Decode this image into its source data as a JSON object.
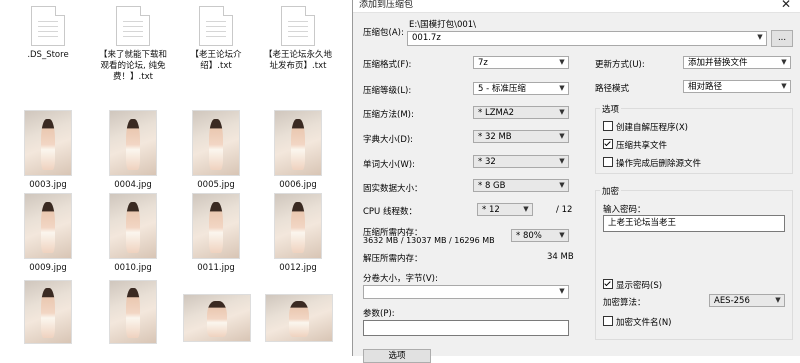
{
  "explorer": {
    "files": [
      {
        "name": ".DS_Store",
        "kind": "doc"
      },
      {
        "name": "【来了就能下载和观看的论坛, 纯免费！】.txt",
        "kind": "doc"
      },
      {
        "name": "【老王论坛介绍】.txt",
        "kind": "doc"
      },
      {
        "name": "【老王论坛永久地址发布页】.txt",
        "kind": "doc"
      },
      {
        "name": "0003.jpg",
        "kind": "photo"
      },
      {
        "name": "0004.jpg",
        "kind": "photo"
      },
      {
        "name": "0005.jpg",
        "kind": "photo"
      },
      {
        "name": "0006.jpg",
        "kind": "photo"
      },
      {
        "name": "0009.jpg",
        "kind": "photo"
      },
      {
        "name": "0010.jpg",
        "kind": "photo"
      },
      {
        "name": "0011.jpg",
        "kind": "photo"
      },
      {
        "name": "0012.jpg",
        "kind": "photo"
      },
      {
        "name": "",
        "kind": "photo"
      },
      {
        "name": "",
        "kind": "photo"
      },
      {
        "name": "",
        "kind": "photo-wide"
      },
      {
        "name": "",
        "kind": "photo-wide"
      }
    ]
  },
  "dialog": {
    "title": "添加到压缩包",
    "close": "✕",
    "archive_label": "压缩包(A):",
    "archive_path": "E:\\国模打包\\001\\",
    "archive_name": "001.7z",
    "browse": "...",
    "format_label": "压缩格式(F):",
    "format_value": "7z",
    "level_label": "压缩等级(L):",
    "level_value": "5 - 标准压缩",
    "method_label": "压缩方法(M):",
    "method_value": "* LZMA2",
    "dict_label": "字典大小(D):",
    "dict_value": "* 32 MB",
    "word_label": "单词大小(W):",
    "word_value": "* 32",
    "solid_label": "固实数据大小：",
    "solid_value": "* 8 GB",
    "cpu_label": "CPU 线程数：",
    "cpu_value": "* 12",
    "cpu_total": "/ 12",
    "mem_label": "压缩所需内存：",
    "mem_values": "3632 MB / 13037 MB / 16296 MB",
    "mem_percent": "* 80%",
    "decomp_label": "解压所需内存：",
    "decomp_value": "34 MB",
    "split_label": "分卷大小，字节(V):",
    "split_value": "",
    "params_label": "参数(P):",
    "params_value": "",
    "ok_partial": "选项",
    "update_label": "更新方式(U):",
    "update_value": "添加并替换文件",
    "path_label": "路径模式",
    "path_value": "相对路径",
    "options_title": "选项",
    "options": [
      {
        "label": "创建自解压程序(X)",
        "checked": false
      },
      {
        "label": "压缩共享文件",
        "checked": true
      },
      {
        "label": "操作完成后删除源文件",
        "checked": false
      }
    ],
    "encrypt_title": "加密",
    "password_label": "输入密码：",
    "password_value": "上老王论坛当老王",
    "show_password_label": "显示密码(S)",
    "show_password_checked": true,
    "enc_method_label": "加密算法：",
    "enc_method_value": "AES-256",
    "encrypt_names_label": "加密文件名(N)",
    "encrypt_names_checked": false
  }
}
